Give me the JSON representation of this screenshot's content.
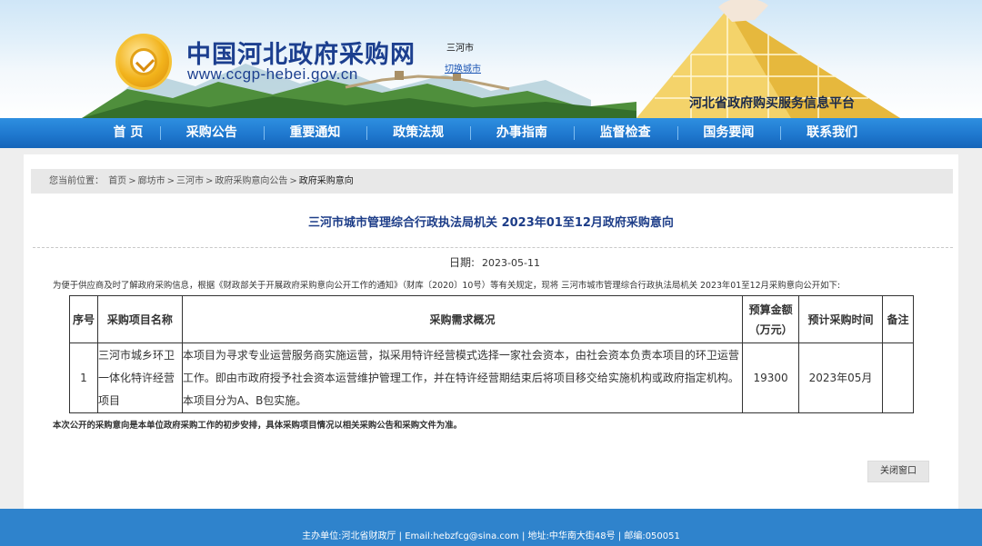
{
  "header": {
    "site_title": "中国河北政府采购网",
    "site_url": "www.ccgp-hebei.gov.cn",
    "city": "三河市",
    "switch_city": "切换城市",
    "platform": "河北省政府购买服务信息平台"
  },
  "nav": {
    "items": [
      {
        "label": "首 页"
      },
      {
        "label": "采购公告"
      },
      {
        "label": "重要通知"
      },
      {
        "label": "政策法规"
      },
      {
        "label": "办事指南"
      },
      {
        "label": "监督检查"
      },
      {
        "label": "国务要闻"
      },
      {
        "label": "联系我们"
      }
    ]
  },
  "breadcrumb": {
    "prefix": "您当前位置：",
    "items": [
      "首页",
      "廊坊市",
      "三河市",
      "政府采购意向公告"
    ],
    "current": "政府采购意向",
    "separator": ">"
  },
  "document": {
    "title": "三河市城市管理综合行政执法局机关 2023年01至12月政府采购意向",
    "date_label": "日期:",
    "date": "2023-05-11",
    "intro": "为便于供应商及时了解政府采购信息，根据《财政部关于开展政府采购意向公开工作的通知》（财库〔2020〕10号）等有关规定，现将 三河市城市管理综合行政执法局机关 2023年01至12月采购意向公开如下:",
    "footnote": "本次公开的采购意向是本单位政府采购工作的初步安排，具体采购项目情况以相关采购公告和采购文件为准。"
  },
  "table": {
    "headers": {
      "no": "序号",
      "name": "采购项目名称",
      "desc": "采购需求概况",
      "budget": "预算金额（万元）",
      "time": "预计采购时间",
      "note": "备注"
    },
    "rows": [
      {
        "no": "1",
        "name": "三河市城乡环卫一体化特许经营项目",
        "desc": "本项目为寻求专业运营服务商实施运营，拟采用特许经营模式选择一家社会资本，由社会资本负责本项目的环卫运营工作。即由市政府授予社会资本运营维护管理工作，并在特许经营期结束后将项目移交给实施机构或政府指定机构。本项目分为A、B包实施。",
        "budget": "19300",
        "time": "2023年05月",
        "note": ""
      }
    ]
  },
  "close_button": "关闭窗口",
  "footer": {
    "text": "主办单位:河北省财政厅 | Email:hebzfcg@sina.com | 地址:中华南大街48号 | 邮编:050051"
  },
  "colors": {
    "nav_blue": "#1f78cf",
    "title_blue": "#1d3d88",
    "footer_blue": "#2f83cc",
    "logo_gold": "#f2b31b"
  },
  "icons": {
    "logo": "coin-emblem-icon"
  }
}
